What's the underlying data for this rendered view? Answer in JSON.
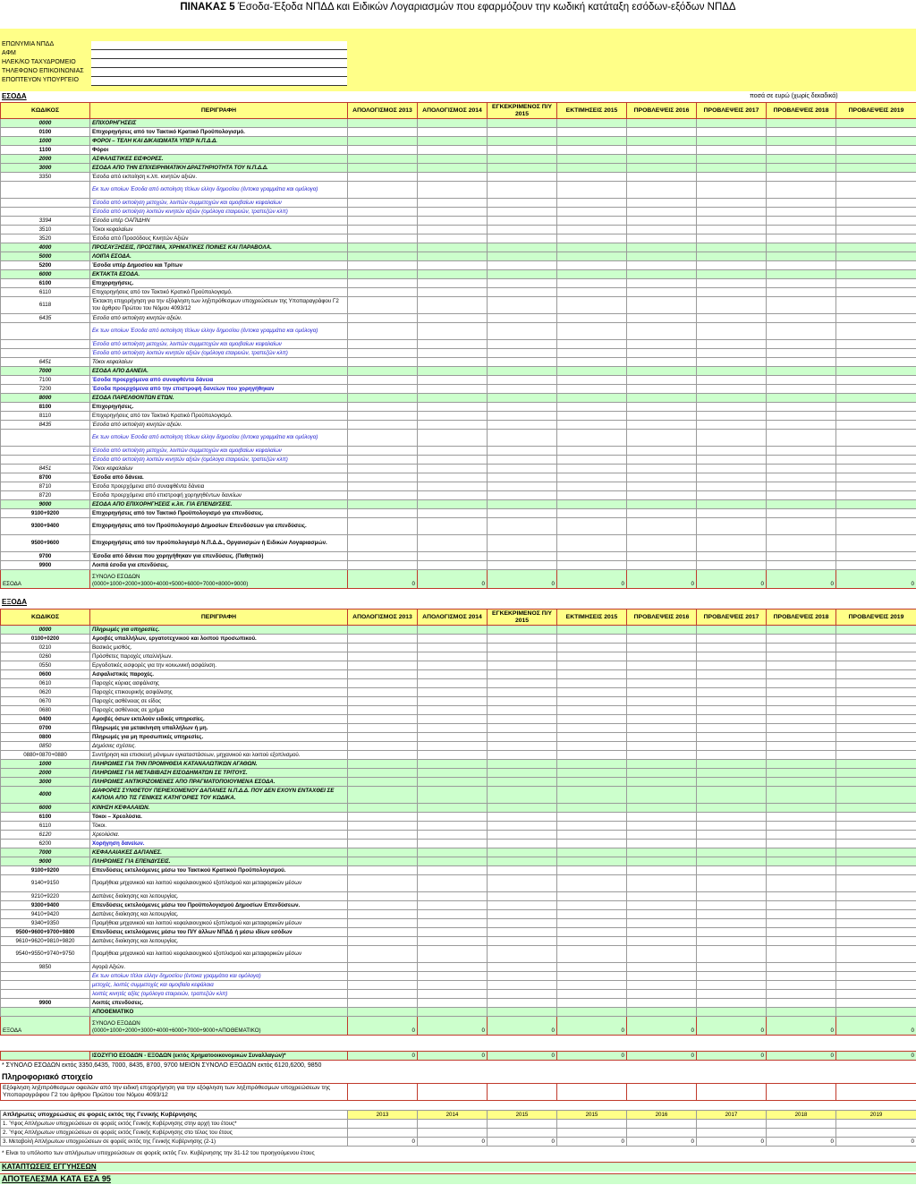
{
  "title": {
    "bold": "ΠΙΝΑΚΑΣ 5",
    "rest": " Έσοδα-Έξοδα ΝΠΔΔ και Ειδικών Λογαριασμών που εφαρμόζουν την κωδική κατάταξη εσόδων-εξόδων ΝΠΔΔ"
  },
  "info": [
    "ΕΠΩΝΥΜΙΑ ΝΠΔΔ",
    "ΑΦΜ",
    "ΗΛΕΚ/ΚΟ ΤΑΧΥΔΡΟΜΕΙΟ",
    "ΤΗΛΕΦΩΝΟ ΕΠΙΚΟΙΝΩΝΙΑΣ",
    "ΕΠΟΠΤΕΥΟΝ ΥΠΟΥΡΓΕΙΟ"
  ],
  "revenue_title": "ΕΣΟΔΑ",
  "amount_note": "ποσά σε ευρώ (χωρίς δεκαδικά)",
  "expense_title": "ΕΞΟΔΑ",
  "headers": {
    "code": "ΚΩΔΙΚΟΣ",
    "desc": "ΠΕΡΙΓΡΑΦΗ",
    "years": [
      "ΑΠΟΛΟΓΙΣΜΟΣ 2013",
      "ΑΠΟΛΟΓΙΣΜΟΣ 2014",
      "ΕΓΚΕΚΡΙΜΕΝΟΣ Π/Υ 2015",
      "ΕΚΤΙΜΗΣΕΙΣ 2015",
      "ΠΡΟΒΛΕΨΕΙΣ 2016",
      "ΠΡΟΒΛΕΨΕΙΣ 2017",
      "ΠΡΟΒΛΕΨΕΙΣ 2018",
      "ΠΡΟΒΛΕΨΕΙΣ 2019"
    ]
  },
  "revenue_rows": [
    {
      "c": "0000",
      "d": "ΕΠΙΧΟΡΗΓΗΣΕΙΣ",
      "s": "green"
    },
    {
      "c": "0100",
      "d": "Επιχορηγήσεις από τον Τακτικό Κρατικό Προϋπολογισμό.",
      "s": "bold"
    },
    {
      "c": "1000",
      "d": "ΦΟΡΟΙ – ΤΕΛΗ ΚΑΙ ΔΙΚΑΙΩΜΑΤΑ ΥΠΕΡ Ν.Π.Δ.Δ.",
      "s": "green"
    },
    {
      "c": "1100",
      "d": "Φόροι",
      "s": "bold"
    },
    {
      "c": "2000",
      "d": "ΑΣΦΑΛΙΣΤΙΚΕΣ ΕΙΣΦΟΡΕΣ.",
      "s": "green"
    },
    {
      "c": "3000",
      "d": "ΕΣΟΔΑ ΑΠΟ ΤΗΝ ΕΠΙΧΕΙΡΗΜΑΤΙΚΗ ΔΡΑΣΤΗΡΙΟΤΗΤΑ ΤΟΥ Ν.Π.Δ.Δ.",
      "s": "green"
    },
    {
      "c": "3350",
      "d": "Έσοδα από εκποίηση κ.λπ. κινητών αξιών.",
      "s": ""
    },
    {
      "c": "",
      "d": "Εκ των οποίων Έσοδα από εκποίηση τίτλων ελλην δημοσίου (έντοκα γραμμάτια και ομόλογα)",
      "s": "blue tall",
      "i": true
    },
    {
      "c": "",
      "d": "Έσοδα από εκποίηση μετοχών, λοιπών συμμετοχών και αμοιβαίων κεφαλαίων",
      "s": "blue",
      "i": true
    },
    {
      "c": "",
      "d": "Έσοδα από εκποίηση λοιπών κινητών αξιών (ομόλογα εταιρειών, τραπεζών κλπ)",
      "s": "blue",
      "i": true
    },
    {
      "c": "3394",
      "d": "Έσοδα υπέρ ΟΑΠΙΔΗΝ",
      "s": "italic"
    },
    {
      "c": "3510",
      "d": "Τόκοι κεφαλαίων",
      "s": ""
    },
    {
      "c": "3520",
      "d": "Έσοδα από Προσόδους Κινητών Αξιών",
      "s": ""
    },
    {
      "c": "4000",
      "d": "ΠΡΟΣΑΥΞΗΣΕΙΣ, ΠΡΟΣΤΙΜΑ, ΧΡΗΜΑΤΙΚΕΣ ΠΟΙΝΕΣ ΚΑΙ ΠΑΡΑΒΟΛΑ.",
      "s": "green"
    },
    {
      "c": "5000",
      "d": "ΛΟΙΠΑ ΕΣΟΔΑ.",
      "s": "green"
    },
    {
      "c": "5200",
      "d": "Έσοδα υπέρ Δημοσίου και Τρίτων",
      "s": "bold"
    },
    {
      "c": "6000",
      "d": "ΕΚΤΑΚΤΑ ΕΣΟΔΑ.",
      "s": "green"
    },
    {
      "c": "6100",
      "d": "Επιχορηγήσεις.",
      "s": "bold"
    },
    {
      "c": "6110",
      "d": "Επιχορηγήσεις από τον Τακτικό Κρατικό Προϋπολογισμό.",
      "s": ""
    },
    {
      "c": "6118",
      "d": "Έκτακτη επιχορήγηση για την εξόφληση των ληξιπρόθεσμων υποχρεώσεων της Υποπαραγράφου Γ2 του άρθρου Πρώτου του Νόμου 4093/12",
      "s": "tall"
    },
    {
      "c": "6435",
      "d": "Έσοδα από εκποίηση κινητών αξιών.",
      "s": "italic"
    },
    {
      "c": "",
      "d": "Εκ των οποίων Έσοδα από εκποίηση τίτλων ελλην δημοσίου (έντοκα γραμμάτια και ομόλογα)",
      "s": "blue tall",
      "i": true
    },
    {
      "c": "",
      "d": "Έσοδα από εκποίηση μετοχών, λοιπών συμμετοχών και αμοιβαίων κεφαλαίων",
      "s": "blue",
      "i": true
    },
    {
      "c": "",
      "d": "Έσοδα από εκποίηση λοιπών κινητών αξιών (ομόλογα εταιρειών, τραπεζών κλπ)",
      "s": "blue",
      "i": true
    },
    {
      "c": "6451",
      "d": "Τόκοι κεφαλαίων",
      "s": "italic"
    },
    {
      "c": "7000",
      "d": "ΕΣΟΔΑ ΑΠΟ ΔΑΝΕΙΑ.",
      "s": "green"
    },
    {
      "c": "7100",
      "d": "Έσοδα προερχόμενα από συναφθέντα δάνεια",
      "s": "blueb"
    },
    {
      "c": "7200",
      "d": "Έσοδα προερχόμενα από την επιστροφή δανείων που χορηγήθηκαν",
      "s": "blueb"
    },
    {
      "c": "8000",
      "d": "ΕΣΟΔΑ ΠΑΡΕΛΘΟΝΤΩΝ ΕΤΩΝ.",
      "s": "green"
    },
    {
      "c": "8100",
      "d": "Επιχορηγήσεις.",
      "s": "bold"
    },
    {
      "c": "8110",
      "d": "Επιχορηγήσεις από τον Τακτικό Κρατικό Προϋπολογισμό.",
      "s": ""
    },
    {
      "c": "8435",
      "d": "Έσοδα από εκποίηση κινητών αξιών.",
      "s": "italic"
    },
    {
      "c": "",
      "d": "Εκ των οποίων Έσοδα από εκποίηση τίτλων ελλην δημοσίου (έντοκα γραμμάτια και ομόλογα)",
      "s": "blue tall",
      "i": true
    },
    {
      "c": "",
      "d": "Έσοδα από εκποίηση μετοχών, λοιπών συμμετοχών και αμοιβαίων κεφαλαίων",
      "s": "blue",
      "i": true
    },
    {
      "c": "",
      "d": "Έσοδα από εκποίηση λοιπών κινητών αξιών (ομόλογα εταιρειών, τραπεζών κλπ)",
      "s": "blue",
      "i": true
    },
    {
      "c": "8451",
      "d": "Τόκοι κεφαλαίων",
      "s": "italic"
    },
    {
      "c": "8700",
      "d": "Έσοδα από δάνεια.",
      "s": "bold"
    },
    {
      "c": "8710",
      "d": "Έσοδα προερχόμενα από συναφθέντα δάνεια",
      "s": ""
    },
    {
      "c": "8720",
      "d": "Έσοδα προερχόμενα από επιστροφή χορηγηθέντων δανείων",
      "s": ""
    },
    {
      "c": "9000",
      "d": "ΕΣΟΔΑ ΑΠΟ ΕΠΙΧΟΡΗΓΗΣΕΙΣ κ.λπ. ΓΙΑ ΕΠΕΝΔΥΣΕΙΣ.",
      "s": "green"
    },
    {
      "c": "9100+9200",
      "d": "Επιχορηγήσεις από τον Τακτικό Προϋπολογισμό για επενδύσεις.",
      "s": "bold"
    },
    {
      "c": "9300+9400",
      "d": "Επιχορηγήσεις από τον Προϋπολογισμό Δημοσίων Επενδύσεων για επενδύσεις.",
      "s": "bold tall"
    },
    {
      "c": "9500+9600",
      "d": "Επιχορηγήσεις από τον προϋπολογισμό Ν.Π.Δ.Δ., Οργανισμών ή Ειδικών Λογαριασμών.",
      "s": "bold tall"
    },
    {
      "c": "9700",
      "d": "Έσοδα από δάνεια που χορηγήθηκαν για επενδύσεις. (Παθητικό)",
      "s": "bold"
    },
    {
      "c": "9900",
      "d": "Λοιπά έσοδα για επενδύσεις.",
      "s": "bold"
    }
  ],
  "revenue_total": {
    "label": "ΕΣΟΔΑ",
    "title": "ΣΥΝΟΛΟ ΕΣΟΔΩΝ",
    "formula": "(0000+1000+2000+3000+4000+5000+6000+7000+8000+9000)",
    "values": [
      "0",
      "0",
      "0",
      "0",
      "0",
      "0",
      "0",
      "0"
    ]
  },
  "expense_rows": [
    {
      "c": "0000",
      "d": "Πληρωμές για υπηρεσίες.",
      "s": "green"
    },
    {
      "c": "0100+0200",
      "d": "Αμοιβές υπαλλήλων, εργατοτεχνικού και λοιπού προσωπικού.",
      "s": "bold"
    },
    {
      "c": "0210",
      "d": "Βασικός μισθός.",
      "s": ""
    },
    {
      "c": "0260",
      "d": "Πρόσθετες παροχές υπαλλήλων.",
      "s": ""
    },
    {
      "c": "0550",
      "d": "Εργοδοτικές εισφορές για την κοινωνική ασφάλιση.",
      "s": ""
    },
    {
      "c": "0600",
      "d": "Ασφαλιστικές παροχές.",
      "s": "bold"
    },
    {
      "c": "0610",
      "d": "Παροχές κύριας ασφάλισης",
      "s": ""
    },
    {
      "c": "0620",
      "d": "Παροχές επικουρικής ασφάλισης",
      "s": ""
    },
    {
      "c": "0670",
      "d": "Παροχές ασθένειας σε είδος",
      "s": ""
    },
    {
      "c": "0680",
      "d": "Παροχές ασθένειας σε χρήμα",
      "s": ""
    },
    {
      "c": "0400",
      "d": "Αμοιβές όσων εκτελούν ειδικές υπηρεσίες.",
      "s": "bold"
    },
    {
      "c": "0700",
      "d": "Πληρωμές για μετακίνηση υπαλλήλων ή μη.",
      "s": "bold"
    },
    {
      "c": "0800",
      "d": "Πληρωμές για μη προσωπικές υπηρεσίες.",
      "s": "bold"
    },
    {
      "c": "0850",
      "d": "Δημόσιες σχέσεις.",
      "s": "italic"
    },
    {
      "c": "0880+0870+0880",
      "d": "Συντήρηση και επισκευή μόνιμων εγκαταστάσεων, μηχανικού και λοιπού εξοπλισμού.",
      "s": ""
    },
    {
      "c": "1000",
      "d": "ΠΛΗΡΩΜΕΣ ΓΙΑ ΤΗΝ ΠΡΟΜΗΘΕΙΑ ΚΑΤΑΝΑΛΩΤΙΚΩΝ ΑΓΑΘΩΝ.",
      "s": "green"
    },
    {
      "c": "2000",
      "d": "ΠΛΗΡΩΜΕΣ ΓΙΑ ΜΕΤΑΒΙΒΑΣΗ ΕΙΣΟΔΗΜΑΤΩΝ ΣΕ ΤΡΙΤΟΥΣ.",
      "s": "green"
    },
    {
      "c": "3000",
      "d": "ΠΛΗΡΩΜΕΣ ΑΝΤΙΚΡΙΖΟΜΕΝΕΣ ΑΠΟ ΠΡΑΓΜΑΤΟΠΟΙΟΥΜΕΝΑ ΕΣΟΔΑ.",
      "s": "green"
    },
    {
      "c": "4000",
      "d": "ΔΙΑΦΟΡΕΣ ΣΥΝΘΕΤΟΥ ΠΕΡΙΕΧΟΜΕΝΟΥ ΔΑΠΑΝΕΣ Ν.Π.Δ.Δ. ΠΟΥ ΔΕΝ ΕΧΟΥΝ ΕΝΤΑΧΘΕΙ ΣΕ ΚΑΠΟΙΑ ΑΠΟ ΤΙΣ ΓΕΝΙΚΕΣ ΚΑΤΗΓΟΡΙΕΣ ΤΟΥ ΚΩΔΙΚΑ.",
      "s": "green tall"
    },
    {
      "c": "6000",
      "d": "ΚΙΝΗΣΗ ΚΕΦΑΛΑΙΩΝ.",
      "s": "green"
    },
    {
      "c": "6100",
      "d": "Τόκοι – Χρεολύσια.",
      "s": "bold"
    },
    {
      "c": "6110",
      "d": "Τόκοι.",
      "s": ""
    },
    {
      "c": "6120",
      "d": "Χρεολύσια.",
      "s": "italic"
    },
    {
      "c": "6200",
      "d": "Χορήγηση δανείων.",
      "s": "blueb"
    },
    {
      "c": "7000",
      "d": "ΚΕΦΑΛΑΙΑΚΕΣ ΔΑΠΑΝΕΣ.",
      "s": "green"
    },
    {
      "c": "9000",
      "d": "ΠΛΗΡΩΜΕΣ ΓΙΑ ΕΠΕΝΔΥΣΕΙΣ.",
      "s": "green"
    },
    {
      "c": "9100+9200",
      "d": "Επενδύσεις εκτελούμενες μέσω του Τακτικού Κρατικού Προϋπολογισμού.",
      "s": "bold"
    },
    {
      "c": "9140+9150",
      "d": "Προμήθεια μηχανικού και λοιπού κεφαλαιουχικού εξοπλισμού και μεταφορικών μέσων",
      "s": "tall"
    },
    {
      "c": "9210+9220",
      "d": "Δαπάνες διοίκησης και λειτουργίας.",
      "s": ""
    },
    {
      "c": "9300+9400",
      "d": "Επενδύσεις εκτελούμενες μέσω του Προϋπολογισμού Δημοσίων Επενδύσεων.",
      "s": "bold"
    },
    {
      "c": "9410+9420",
      "d": "Δαπάνες διοίκησης και λειτουργίας.",
      "s": ""
    },
    {
      "c": "9340+9350",
      "d": "Προμήθεια μηχανικού και λοιπού κεφαλαιουχικού εξοπλισμού και μεταφορικών μέσων",
      "s": ""
    },
    {
      "c": "9500+9600+9700+9800",
      "d": "Επενδύσεις εκτελούμενες μέσω του Π/Υ άλλων ΝΠΔΔ ή μέσω ιδίων εσόδων",
      "s": "bold"
    },
    {
      "c": "9610+9620+9810+9820",
      "d": "Δαπάνες διοίκησης και λειτουργίας.",
      "s": ""
    },
    {
      "c": "9540+9550+9740+9750",
      "d": "Προμήθεια μηχανικού και λοιπού κεφαλαιουχικού εξοπλισμού και μεταφορικών μέσων",
      "s": "tall"
    },
    {
      "c": "9850",
      "d": "Αγορά Αξιών.",
      "s": ""
    },
    {
      "c": "",
      "d": "Εκ των οποίων τίτλοι ελλην δημοσίου (έντοκα γραμμάτια και ομόλογα)",
      "s": "blue",
      "i": true
    },
    {
      "c": "",
      "d": "μετοχές, λοιπές συμμετοχές και αμοιβαία κεφάλαια",
      "s": "blue"
    },
    {
      "c": "",
      "d": "λοιπές κινητές αξίες (ομόλογα εταιρειών, τραπεζών κλπ)",
      "s": "blue",
      "i": true
    },
    {
      "c": "9900",
      "d": "Λοιπές επενδύσεις.",
      "s": "bold"
    },
    {
      "c": "",
      "d": "ΑΠΟΘΕΜΑΤΙΚΟ",
      "s": "bold green2"
    }
  ],
  "expense_total": {
    "label": "ΕΞΟΔΑ",
    "title": "ΣΥΝΟΛΟ ΕΞΟΔΩΝ",
    "formula": "(0000+1000+2000+3000+4000+6000+7000+9000+ΑΠΟΘΕΜΑΤΙΚΟ)",
    "values": [
      "0",
      "0",
      "0",
      "0",
      "0",
      "0",
      "0",
      "0"
    ]
  },
  "balance": {
    "label": "ΙΣΟΖΥΓΙΟ ΕΣΟΔΩΝ - ΕΞΟΔΩΝ (εκτός Χρηματοοικονομικών Συναλλαγών)*",
    "values": [
      "0",
      "0",
      "0",
      "0",
      "0",
      "0",
      "0",
      "0"
    ]
  },
  "footnote1": "* ΣΥΝΟΛΟ ΕΣΟΔΩΝ εκτός 3350,6435, 7000, 8435, 8700, 9700 ΜΕΙΟΝ ΣΥΝΟΛΟ ΕΞΟΔΩΝ εκτός 6120,6200, 9850",
  "info_heading": "Πληροφοριακό στοιχείο",
  "info_text": "Εξόφληση ληξιπρόθεσμων οφειλών από την ειδική επιχορήγηση για την εξόφληση των ληξιπρόθεσμων υποχρεώσεων της Υποπαραγράφου Γ2 του άρθρου Πρώτου του Νόμου 4093/12",
  "arrears": {
    "title": "Απλήρωτες υποχρεώσεις σε φορείς εκτός της Γενικής Κυβέρνησης",
    "years": [
      "2013",
      "2014",
      "2015",
      "2015",
      "2016",
      "2017",
      "2018",
      "2019"
    ],
    "rows": [
      {
        "d": "1. Ύψος Απλήρωτων υποχρεώσεων σε φορείς εκτός Γενικής Κυβέρνησης στην αρχή του έτους*",
        "v": [
          "",
          "",
          "",
          "",
          "",
          "",
          "",
          ""
        ]
      },
      {
        "d": "2. Ύψος Απλήρωτων υποχρεώσεων σε φορείς εκτός Γενικής Κυβέρνησης στο τέλος του έτους",
        "v": [
          "",
          "",
          "",
          "",
          "",
          "",
          "",
          ""
        ]
      },
      {
        "d": "3. Μεταβολή Απλήρωτων υποχρεώσεων σε φορείς εκτός της Γενικής Κυβέρνησης (2-1)",
        "v": [
          "0",
          "0",
          "0",
          "0",
          "0",
          "0",
          "0",
          "0"
        ]
      }
    ]
  },
  "footnote2": "* Είναι το υπόλοιπο των απλήρωτων υποχρεώσεων σε φορείς εκτός Γεν. Κυβέρνησης την 31-12 του προηγούμενου έτους",
  "guarantees": "ΚΑΤΑΠΤΩΣΕΙΣ ΕΓΓΥΗΣΕΩΝ",
  "esa": "ΑΠΟΤΕΛΕΣΜΑ ΚΑΤΑ ΕΣΑ 95"
}
